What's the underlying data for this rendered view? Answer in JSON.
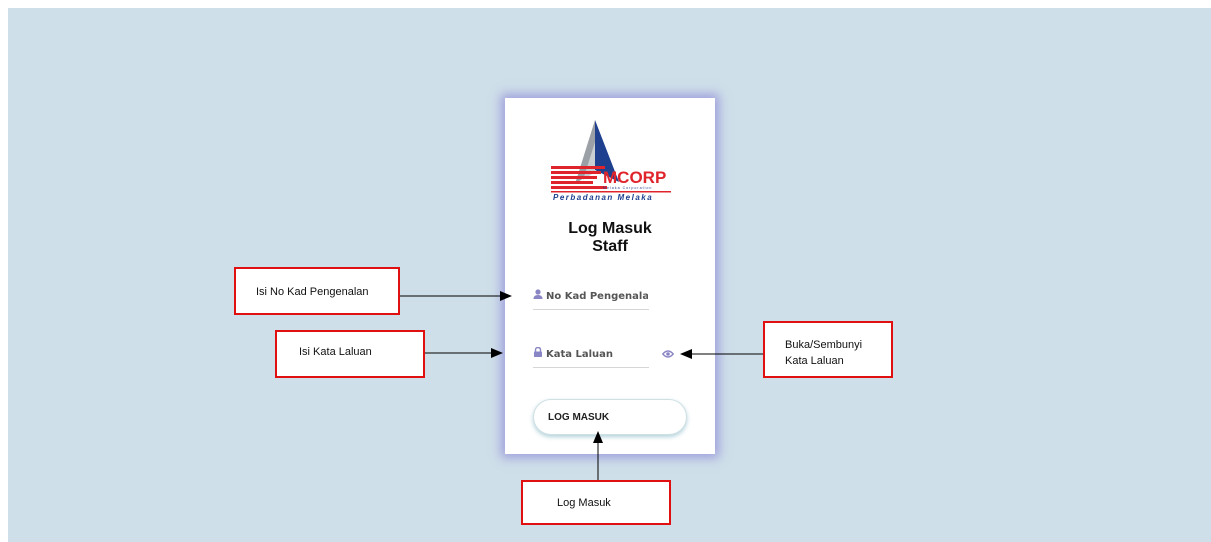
{
  "login": {
    "logo": {
      "brand": "MCORP",
      "subtitle": "Melaka Corporation",
      "tagline": "Perbadanan Melaka"
    },
    "title_line1": "Log Masuk",
    "title_line2": "Staff",
    "ic_field": {
      "placeholder": "No Kad Pengenalan",
      "value": "",
      "icon": "user-icon"
    },
    "password_field": {
      "placeholder": "Kata Laluan",
      "value": "",
      "icon": "lock-icon"
    },
    "toggle_icon": "eye-icon",
    "submit_label": "LOG MASUK"
  },
  "annotations": {
    "ic": "Isi No Kad Pengenalan",
    "password": "Isi Kata Laluan",
    "toggle_line1": "Buka/Sembunyi",
    "toggle_line2": "Kata Laluan",
    "submit": "Log Masuk"
  },
  "colors": {
    "background": "#cfdfe9",
    "callout_border": "#e01010",
    "brand_red": "#e0242c",
    "brand_blue": "#1f3f8f",
    "icon": "#8a85c4"
  }
}
